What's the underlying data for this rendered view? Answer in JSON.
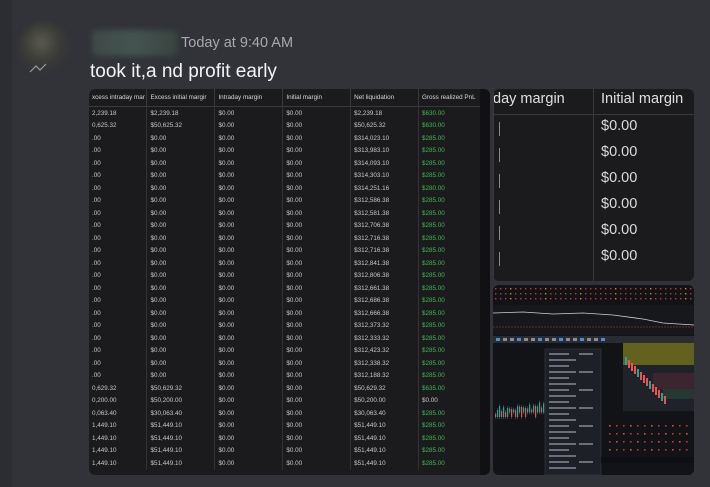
{
  "message": {
    "timestamp": "Today at 9:40 AM",
    "text": "took it,a nd profit early"
  },
  "table": {
    "headers": [
      "xcess intraday mar",
      "Excess initial margir",
      "Intraday margin",
      "Initial margin",
      "Net liquidation",
      "Gross realized PnL"
    ],
    "rows": [
      [
        "2,239.18",
        "$2,239.18",
        "$0.00",
        "$0.00",
        "$2,239.18",
        "$630.00"
      ],
      [
        "0,625.32",
        "$50,625.32",
        "$0.00",
        "$0.00",
        "$50,625.32",
        "$630.00"
      ],
      [
        ".00",
        "$0.00",
        "$0.00",
        "$0.00",
        "$314,023.10",
        "$285.00"
      ],
      [
        ".00",
        "$0.00",
        "$0.00",
        "$0.00",
        "$313,983.10",
        "$285.00"
      ],
      [
        ".00",
        "$0.00",
        "$0.00",
        "$0.00",
        "$314,093.10",
        "$285.00"
      ],
      [
        ".00",
        "$0.00",
        "$0.00",
        "$0.00",
        "$314,303.10",
        "$285.00"
      ],
      [
        ".00",
        "$0.00",
        "$0.00",
        "$0.00",
        "$314,251.16",
        "$280.00"
      ],
      [
        ".00",
        "$0.00",
        "$0.00",
        "$0.00",
        "$312,586.38",
        "$285.00"
      ],
      [
        ".00",
        "$0.00",
        "$0.00",
        "$0.00",
        "$312,581.38",
        "$285.00"
      ],
      [
        ".00",
        "$0.00",
        "$0.00",
        "$0.00",
        "$312,706.38",
        "$285.00"
      ],
      [
        ".00",
        "$0.00",
        "$0.00",
        "$0.00",
        "$312,716.38",
        "$285.00"
      ],
      [
        ".00",
        "$0.00",
        "$0.00",
        "$0.00",
        "$312,716.38",
        "$285.00"
      ],
      [
        ".00",
        "$0.00",
        "$0.00",
        "$0.00",
        "$312,841.38",
        "$285.00"
      ],
      [
        ".00",
        "$0.00",
        "$0.00",
        "$0.00",
        "$312,806.38",
        "$285.00"
      ],
      [
        ".00",
        "$0.00",
        "$0.00",
        "$0.00",
        "$312,661.38",
        "$285.00"
      ],
      [
        ".00",
        "$0.00",
        "$0.00",
        "$0.00",
        "$312,686.38",
        "$285.00"
      ],
      [
        ".00",
        "$0.00",
        "$0.00",
        "$0.00",
        "$312,666.38",
        "$285.00"
      ],
      [
        ".00",
        "$0.00",
        "$0.00",
        "$0.00",
        "$312,373.32",
        "$285.00"
      ],
      [
        ".00",
        "$0.00",
        "$0.00",
        "$0.00",
        "$312,333.32",
        "$285.00"
      ],
      [
        ".00",
        "$0.00",
        "$0.00",
        "$0.00",
        "$312,423.32",
        "$285.00"
      ],
      [
        ".00",
        "$0.00",
        "$0.00",
        "$0.00",
        "$312,338.32",
        "$285.00"
      ],
      [
        ".00",
        "$0.00",
        "$0.00",
        "$0.00",
        "$312,188.32",
        "$285.00"
      ],
      [
        "0,629.32",
        "$50,629.32",
        "$0.00",
        "$0.00",
        "$50,629.32",
        "$635.00"
      ],
      [
        "0,200.00",
        "$50,200.00",
        "$0.00",
        "$0.00",
        "$50,200.00",
        "$0.00"
      ],
      [
        "0,063.40",
        "$30,063.40",
        "$0.00",
        "$0.00",
        "$30,063.40",
        "$285.00"
      ],
      [
        "1,449.10",
        "$51,449.10",
        "$0.00",
        "$0.00",
        "$51,449.10",
        "$285.00"
      ],
      [
        "1,449.10",
        "$51,449.10",
        "$0.00",
        "$0.00",
        "$51,449.10",
        "$285.00"
      ],
      [
        "1,449.10",
        "$51,449.10",
        "$0.00",
        "$0.00",
        "$51,449.10",
        "$285.00"
      ],
      [
        "1,449.10",
        "$51,449.10",
        "$0.00",
        "$0.00",
        "$51,449.10",
        "$285.00"
      ]
    ]
  },
  "margin_crop": {
    "header_left": "day margin",
    "header_right": "Initial margin",
    "values": [
      "$0.00",
      "$0.00",
      "$0.00",
      "$0.00",
      "$0.00",
      "$0.00"
    ]
  },
  "colors": {
    "background": "#313338",
    "pnl_green": "#3fb950",
    "candle_up": "#26a69a",
    "candle_down": "#ef5350"
  }
}
